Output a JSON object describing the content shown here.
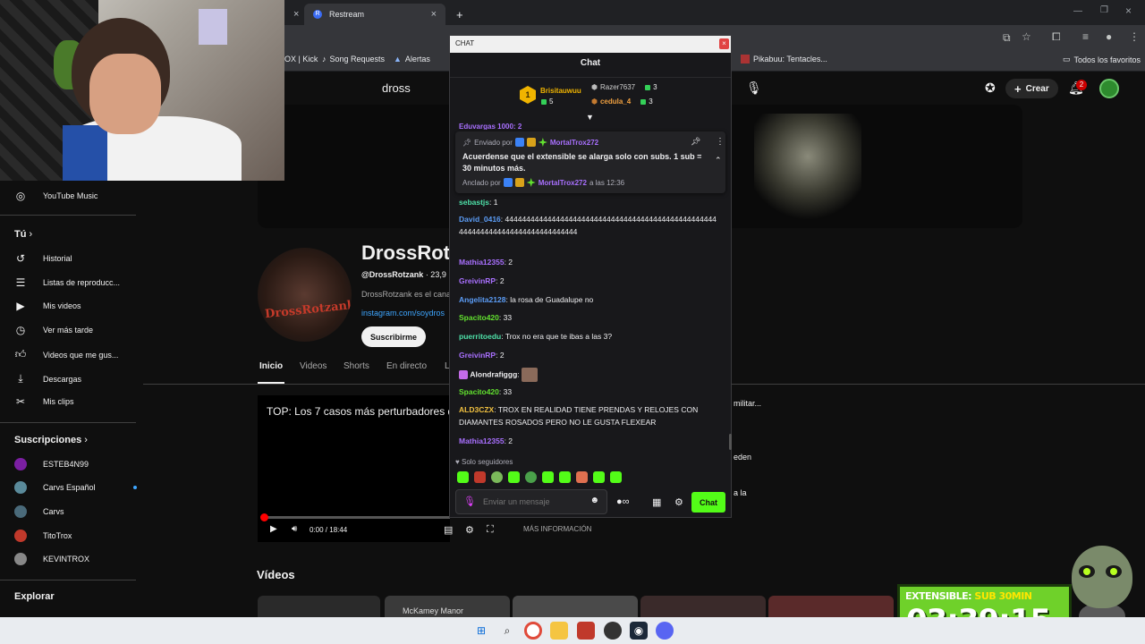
{
  "browser": {
    "tabs": [
      {
        "label": "Restream"
      }
    ],
    "bookmarks": [
      {
        "label": "OX | Kick"
      },
      {
        "label": "Song Requests"
      },
      {
        "label": "Alertas"
      },
      {
        "label": "Pikabuu: Tentacles..."
      },
      {
        "label": "Todos los favoritos"
      }
    ]
  },
  "youtube": {
    "search_value": "dross",
    "crear_label": "Crear",
    "notification_count": "2",
    "sidebar": {
      "music_label": "YouTube Music",
      "tu_label": "Tú",
      "items": [
        {
          "label": "Historial",
          "icon": "history-icon"
        },
        {
          "label": "Listas de reproducc...",
          "icon": "playlist-icon"
        },
        {
          "label": "Mis videos",
          "icon": "video-icon"
        },
        {
          "label": "Ver más tarde",
          "icon": "clock-icon"
        },
        {
          "label": "Videos que me gus...",
          "icon": "like-icon"
        },
        {
          "label": "Descargas",
          "icon": "download-icon"
        },
        {
          "label": "Mis clips",
          "icon": "scissors-icon"
        }
      ],
      "subs_label": "Suscripciones",
      "subscriptions": [
        {
          "label": "ESTEB4N99",
          "color": "#7b1fa2"
        },
        {
          "label": "Carvs Español",
          "color": "#5a8a9a"
        },
        {
          "label": "Carvs",
          "color": "#4a6a7a"
        },
        {
          "label": "TitoTrox",
          "color": "#c0392b"
        },
        {
          "label": "KEVINTROX",
          "color": "#888888"
        }
      ],
      "explore_label": "Explorar"
    },
    "channel": {
      "name": "DrossRotz",
      "handle": "@DrossRotzank",
      "subs_fragment": "· 23,9 M",
      "description": "DrossRotzank es el cana",
      "link": "instagram.com/soydros",
      "subscribe_label": "Suscribirme",
      "avatar_text": "DrossRotzank"
    },
    "tabs": [
      "Inicio",
      "Videos",
      "Shorts",
      "En directo",
      "L"
    ],
    "player": {
      "title": "TOP: Los 7 casos más perturbadores d",
      "time": "0:00 / 18:44",
      "more_info": "MÁS INFORMACIÓN"
    },
    "right_fragments": [
      "militar...",
      "eden",
      "a la"
    ],
    "videos_heading": "Vídeos",
    "thumb_text": "McKamey Manor"
  },
  "chat": {
    "window_title": "CHAT",
    "header": "Chat",
    "leaderboard": {
      "first": {
        "rank": "1",
        "name": "Brisitauwuu",
        "count": "5"
      },
      "second": {
        "name": "Razer7637",
        "count": "3"
      },
      "third": {
        "name": "cedula_4",
        "count": "3"
      }
    },
    "pinned": {
      "sent_by_label": "Enviado por",
      "author": "MortalTrox272",
      "message": "Acuerdense que el extensible se alarga solo con subs. 1 sub = 30 minutos más.",
      "pinned_by_label": "Anclado por",
      "pinned_time": "a las 12:36"
    },
    "cut_user": "Eduvargas 1000: 2",
    "messages": [
      {
        "user": "sebastjs",
        "color": "#4ee0a8",
        "text": "1"
      },
      {
        "user": "David_0416",
        "color": "#5b9cf5",
        "text": "444444444444444444444444444444444444444444444444444444444444444444444444444444"
      },
      {
        "user": "Mathia12355",
        "color": "#a970ff",
        "text": "2"
      },
      {
        "user": "GreivinRP",
        "color": "#a970ff",
        "text": "2"
      },
      {
        "user": "Angelita2128",
        "color": "#5b9cf5",
        "text": "la rosa de Guadalupe no"
      },
      {
        "user": "Spacito420",
        "color": "#62e02f",
        "text": "33"
      },
      {
        "user": "puerritoedu",
        "color": "#4ee0a8",
        "text": "Trox no era que te ibas a las 3?"
      },
      {
        "user": "GreivinRP",
        "color": "#a970ff",
        "text": "2"
      },
      {
        "user": "Alondrafiggg",
        "color": "#efeff1",
        "text": ""
      },
      {
        "user": "Spacito420",
        "color": "#62e02f",
        "text": "33"
      },
      {
        "user": "ALD3CZX",
        "color": "#f0c040",
        "text": "TROX EN REALIDAD TIENE PRENDAS Y RELOJES CON DIAMANTES ROSADOS PERO NO LE GUSTA FLEXEAR"
      },
      {
        "user": "Mathia12355",
        "color": "#a970ff",
        "text": "2"
      }
    ],
    "follower_mode": "Solo seguidores",
    "input_placeholder": "Enviar un mensaje",
    "send_label": "Chat"
  },
  "overlay": {
    "label_white": "EXTENSIBLE:",
    "label_yellow": "SUB 30MIN",
    "timer": "03:39:15"
  },
  "colors": {
    "kick_green": "#53fc18",
    "yt_bg": "#0f0f0f",
    "chat_bg": "#18181b"
  }
}
